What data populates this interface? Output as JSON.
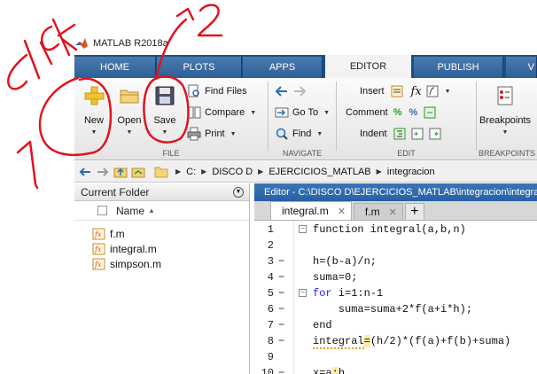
{
  "window": {
    "title": "MATLAB R2018a"
  },
  "ribbon_tabs": [
    {
      "label": "HOME",
      "active": false
    },
    {
      "label": "PLOTS",
      "active": false
    },
    {
      "label": "APPS",
      "active": false
    },
    {
      "label": "EDITOR",
      "active": true
    },
    {
      "label": "PUBLISH",
      "active": false
    },
    {
      "label": "V",
      "active": false
    }
  ],
  "toolbar": {
    "file": {
      "new_label": "New",
      "open_label": "Open",
      "save_label": "Save",
      "find_files_label": "Find Files",
      "compare_label": "Compare",
      "print_label": "Print",
      "group_label": "FILE"
    },
    "navigate": {
      "goto_label": "Go To",
      "find_label": "Find",
      "group_label": "NAVIGATE"
    },
    "edit": {
      "insert_label": "Insert",
      "comment_label": "Comment",
      "indent_label": "Indent",
      "fx_symbol": "fx",
      "group_label": "EDIT"
    },
    "breakpoints": {
      "label": "Breakpoints",
      "group_label": "BREAKPOINTS"
    }
  },
  "address_bar": {
    "path": [
      "C:",
      "DISCO D",
      "EJERCICIOS_MATLAB",
      "integracion"
    ]
  },
  "current_folder": {
    "title": "Current Folder",
    "column_name": "Name",
    "sort_indicator": "▲",
    "files": [
      "f.m",
      "integral.m",
      "simpson.m"
    ]
  },
  "editor": {
    "title": "Editor - C:\\DISCO D\\EJERCICIOS_MATLAB\\integracion\\integral.m",
    "tabs": [
      {
        "label": "integral.m",
        "active": true
      },
      {
        "label": "f.m",
        "active": false
      }
    ],
    "close_symbol": "✕",
    "add_tab_symbol": "+",
    "lines": [
      {
        "num": "1",
        "dash": "",
        "fold": "−",
        "code": "function integral(a,b,n)"
      },
      {
        "num": "2",
        "dash": "",
        "fold": "",
        "code": ""
      },
      {
        "num": "3",
        "dash": "−",
        "fold": "",
        "code": "h=(b-a)/n;"
      },
      {
        "num": "4",
        "dash": "−",
        "fold": "",
        "code": "suma=0;"
      },
      {
        "num": "5",
        "dash": "−",
        "fold": "−",
        "code": "for i=1:n-1"
      },
      {
        "num": "6",
        "dash": "−",
        "fold": "",
        "code": "    suma=suma+2*f(a+i*h);"
      },
      {
        "num": "7",
        "dash": "−",
        "fold": "",
        "code": "end"
      },
      {
        "num": "8",
        "dash": "−",
        "fold": "",
        "code": "integral=(h/2)*(f(a)+f(b)+suma)"
      },
      {
        "num": "9",
        "dash": "",
        "fold": "",
        "code": ""
      },
      {
        "num": "10",
        "dash": "−",
        "fold": "",
        "code": "x=a:h"
      }
    ]
  },
  "annotations": {
    "click_text": "click",
    "number_one": "1",
    "number_two": "2",
    "color": "#e0141e"
  }
}
